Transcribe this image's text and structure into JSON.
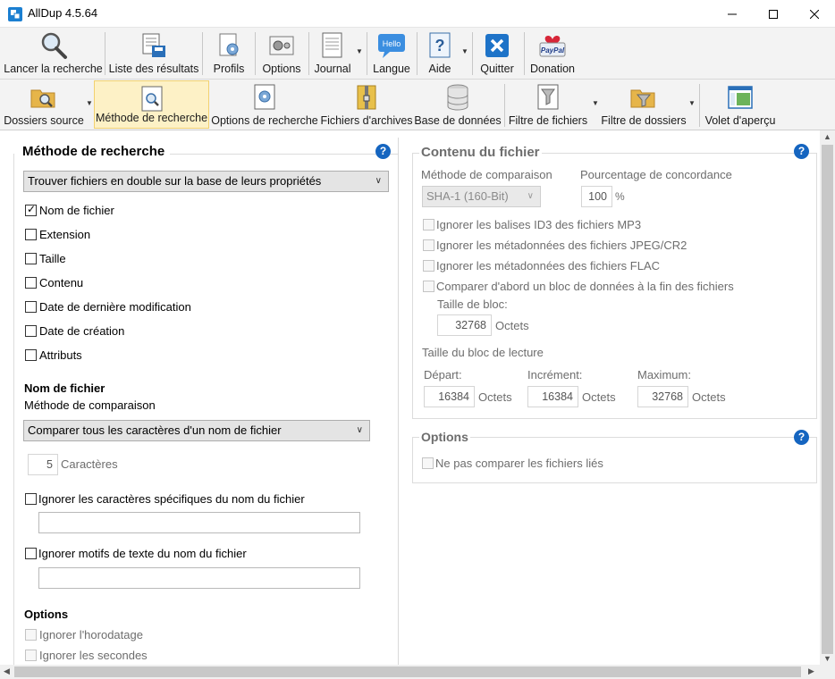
{
  "window": {
    "title": "AllDup 4.5.64",
    "controls": [
      "minimize",
      "maximize",
      "close"
    ]
  },
  "toolbar_main": [
    {
      "name": "lancer-la-recherche",
      "label": "Lancer la recherche",
      "icon": "magnifier-icon"
    },
    {
      "name": "liste-des-resultats",
      "label": "Liste des résultats",
      "icon": "results-list-icon"
    },
    {
      "name": "profils",
      "label": "Profils",
      "icon": "profiles-icon"
    },
    {
      "name": "options",
      "label": "Options",
      "icon": "options-icon"
    },
    {
      "name": "journal",
      "label": "Journal",
      "icon": "journal-icon"
    },
    {
      "name": "langue",
      "label": "Langue",
      "icon": "hello-bubble-icon",
      "icon_text": "Hello"
    },
    {
      "name": "aide",
      "label": "Aide",
      "icon": "help-document-icon"
    },
    {
      "name": "quitter",
      "label": "Quitter",
      "icon": "exit-x-icon"
    },
    {
      "name": "donation",
      "label": "Donation",
      "icon": "paypal-heart-icon",
      "icon_text": "PayPal"
    }
  ],
  "toolbar_views": [
    {
      "name": "dossiers-source",
      "label": "Dossiers source",
      "icon": "folder-search-icon",
      "active": false
    },
    {
      "name": "methode-de-recherche",
      "label": "Méthode de recherche",
      "icon": "search-doc-icon",
      "active": true
    },
    {
      "name": "options-de-recherche",
      "label": "Options de recherche",
      "icon": "search-options-icon",
      "active": false
    },
    {
      "name": "fichiers-d-archives",
      "label": "Fichiers d'archives",
      "icon": "archive-icon",
      "active": false
    },
    {
      "name": "base-de-donnees",
      "label": "Base de données",
      "icon": "database-icon",
      "active": false
    },
    {
      "name": "filtre-de-fichiers",
      "label": "Filtre de fichiers",
      "icon": "file-filter-icon",
      "active": false
    },
    {
      "name": "filtre-de-dossiers",
      "label": "Filtre de dossiers",
      "icon": "folder-filter-icon",
      "active": false
    },
    {
      "name": "volet-d-apercu",
      "label": "Volet d'aperçu",
      "icon": "preview-pane-icon",
      "active": false
    }
  ],
  "left": {
    "title": "Méthode de recherche",
    "method_select": "Trouver fichiers en double sur la base de leurs propriétés",
    "properties": [
      {
        "label": "Nom de fichier",
        "checked": true
      },
      {
        "label": "Extension",
        "checked": false
      },
      {
        "label": "Taille",
        "checked": false
      },
      {
        "label": "Contenu",
        "checked": false
      },
      {
        "label": "Date de dernière modification",
        "checked": false
      },
      {
        "label": "Date de création",
        "checked": false
      },
      {
        "label": "Attributs",
        "checked": false
      }
    ],
    "filename_section": "Nom de fichier",
    "comparison_label": "Méthode de comparaison",
    "comparison_select": "Comparer tous les caractères d'un nom de fichier",
    "char_count": "5",
    "char_unit": "Caractères",
    "ignore_chars": {
      "label": "Ignorer les caractères spécifiques du nom du fichier",
      "checked": false,
      "value": ""
    },
    "ignore_patterns": {
      "label": "Ignorer motifs de texte du nom du fichier",
      "checked": false,
      "value": ""
    },
    "options_title": "Options",
    "ignore_timestamp": "Ignorer l'horodatage",
    "ignore_seconds": "Ignorer les secondes"
  },
  "right": {
    "content_title": "Contenu du fichier",
    "comparison_label": "Méthode de comparaison",
    "comparison_select": "SHA-1 (160-Bit)",
    "match_label": "Pourcentage de concordance",
    "match_value": "100",
    "match_unit": "%",
    "checks": [
      "Ignorer les balises ID3 des fichiers MP3",
      "Ignorer les métadonnées des fichiers JPEG/CR2",
      "Ignorer les métadonnées des fichiers FLAC",
      "Comparer d'abord un bloc de données à la fin des fichiers"
    ],
    "block_size_label": "Taille de bloc:",
    "block_size_value": "32768",
    "unit": "Octets",
    "read_block_label": "Taille du bloc de lecture",
    "start_label": "Départ:",
    "start_value": "16384",
    "increment_label": "Incrément:",
    "increment_value": "16384",
    "max_label": "Maximum:",
    "max_value": "32768",
    "options_title": "Options",
    "no_linked": "Ne pas comparer les fichiers liés"
  }
}
